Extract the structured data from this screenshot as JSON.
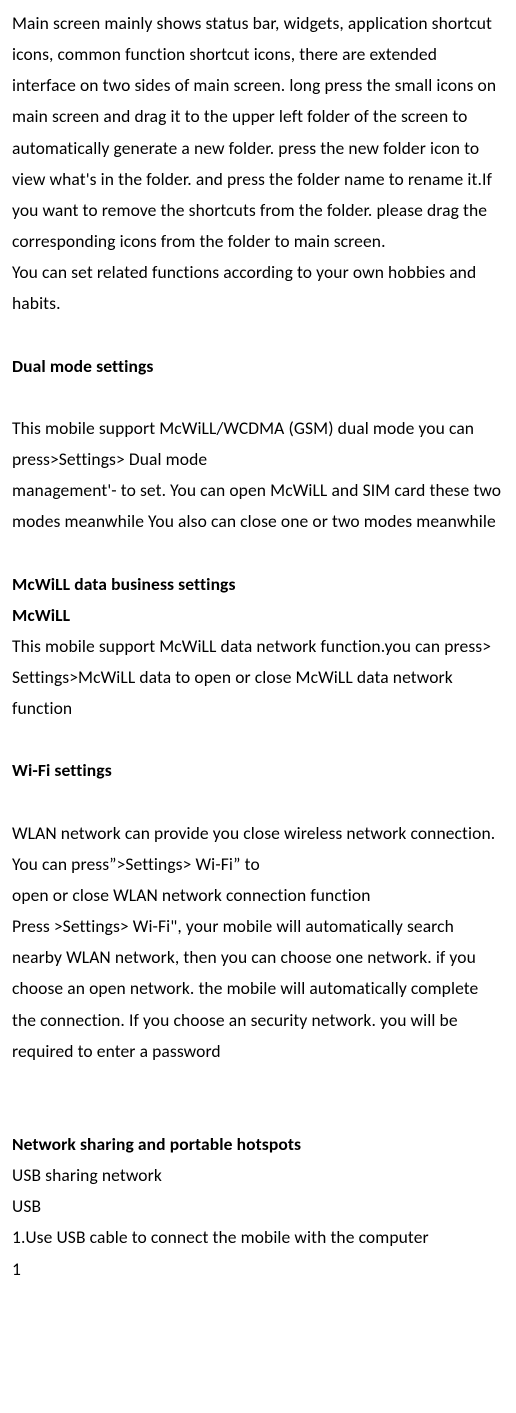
{
  "intro_paragraph": "Main screen mainly shows status bar, widgets, application shortcut icons, common function shortcut icons, there are extended interface on two sides of main screen. long press the small icons on main screen and drag it to the upper left folder of the screen to automatically generate a new folder. press the new folder icon to view what's in the folder. and press the folder name to rename it.If you want to remove the shortcuts from the folder. please drag the corresponding icons from the folder to main screen.",
  "intro_line2": "You can set related functions according to your own hobbies and habits.",
  "dual_mode_heading": "Dual mode settings",
  "dual_mode_body": "This mobile support McWiLL/WCDMA (GSM) dual mode you can press>Settings> Dual mode",
  "dual_mode_body2": "management'- to set. You can open McWiLL and SIM card these two modes meanwhile You also can close one or two modes meanwhile",
  "mcwill_heading": "McWiLL data business settings",
  "mcwill_subheading": "McWiLL",
  "mcwill_body": "This mobile support McWiLL data network function.you can press> Settings>McWiLL data to open or close McWiLL data network function",
  "wifi_heading": "Wi-Fi settings",
  "wifi_body1": "WLAN network can provide you close wireless network connection. You can press”>Settings> Wi-Fi” to",
  "wifi_body2": "open or close WLAN network connection function",
  "wifi_body3": "Press >Settings> Wi-Fi\", your mobile will automatically search nearby WLAN network, then you can choose one network. if you choose an open network. the mobile will automatically complete the connection. If you choose an security network. you will be required to enter a password",
  "network_heading": "Network sharing and portable hotspots",
  "network_line1": "USB sharing network",
  "network_line2": "USB",
  "network_line3": "1.Use USB cable to connect the mobile with the computer",
  "page_number": "1"
}
